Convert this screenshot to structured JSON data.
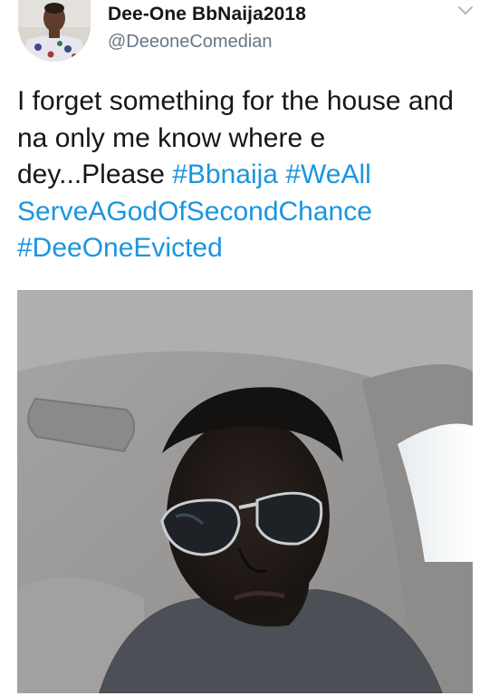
{
  "author": {
    "display_name": "Dee-One BbNaija2018",
    "username": "@DeeoneComedian"
  },
  "tweet": {
    "text_before_tags": "I forget something for the house and na only me know where e dey...Please ",
    "hashtag_1": "#Bbnaija",
    "hashtag_2": "#WeAllServeAGodOfSecondChance",
    "hashtag_2_line1": "#WeAll",
    "hashtag_2_line2": "ServeAGodOfSecondChance",
    "hashtag_3": "#DeeOneEvicted"
  },
  "icons": {
    "menu": "chevron-down-icon"
  },
  "colors": {
    "text": "#14171a",
    "secondary": "#657786",
    "hashtag": "#1b95e0",
    "chevron": "#aab8c2"
  }
}
